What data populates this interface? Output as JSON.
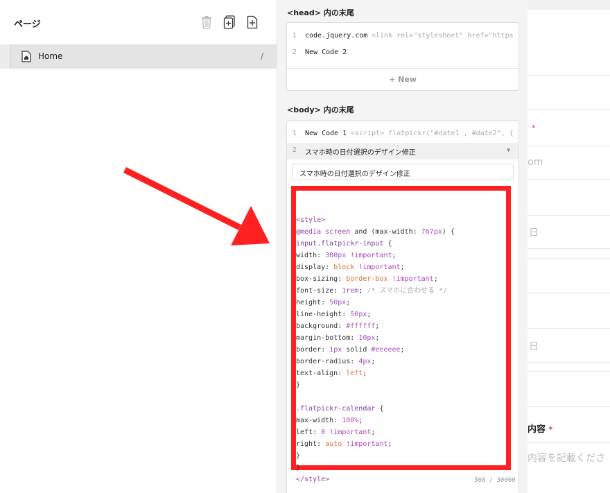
{
  "left_panel": {
    "title": "ページ",
    "pages": [
      {
        "name": "Home",
        "slug": "/"
      }
    ]
  },
  "head_section": {
    "label": "<head> 内の末尾",
    "codes": [
      {
        "line": "1",
        "name": "code.jquery.com",
        "preview": "<link rel=\"stylesheet\" href=\"https"
      },
      {
        "line": "2",
        "name": "New Code 2",
        "preview": ""
      }
    ],
    "new_label": "+ New"
  },
  "body_section": {
    "label": "<body> 内の末尾",
    "codes": [
      {
        "line": "1",
        "name": "New Code 1",
        "preview": "<script> flatpickr(\"#date1 , #date2\", {"
      },
      {
        "line": "2",
        "name": "スマホ時の日付選択のデザイン修正",
        "preview": ""
      }
    ],
    "selected_title": "スマホ時の日付選択のデザイン修正",
    "char_count": "508 / 30000"
  },
  "code_lines": [
    "",
    "<style>",
    "@media screen and (max-width: 767px) {",
    "input.flatpickr-input {",
    "width: 300px !important;",
    "display: block !important;",
    "box-sizing: border-box !important;",
    "font-size: 1rem; /* スマホに合わせる */",
    "height: 50px;",
    "line-height: 50px;",
    "background: #ffffff;",
    "margin-bottom: 10px;",
    "border: 1px solid #eeeeee;",
    "border-radius: 4px;",
    "text-align: left;",
    "}",
    "",
    ".flatpickr-calendar {",
    "max-width: 100%;",
    "left: 0 !important;",
    "right: auto !important;",
    "}",
    "}",
    "</style>"
  ],
  "right_panel": {
    "required_mark": "*",
    "email_partial": "om",
    "date_partial_1": "日",
    "date_partial_2": "日",
    "content_label_partial": "内容",
    "content_placeholder_partial": "内容を記載くださ"
  },
  "colors": {
    "highlight": "#ff2121",
    "arrow": "#ff2121"
  }
}
